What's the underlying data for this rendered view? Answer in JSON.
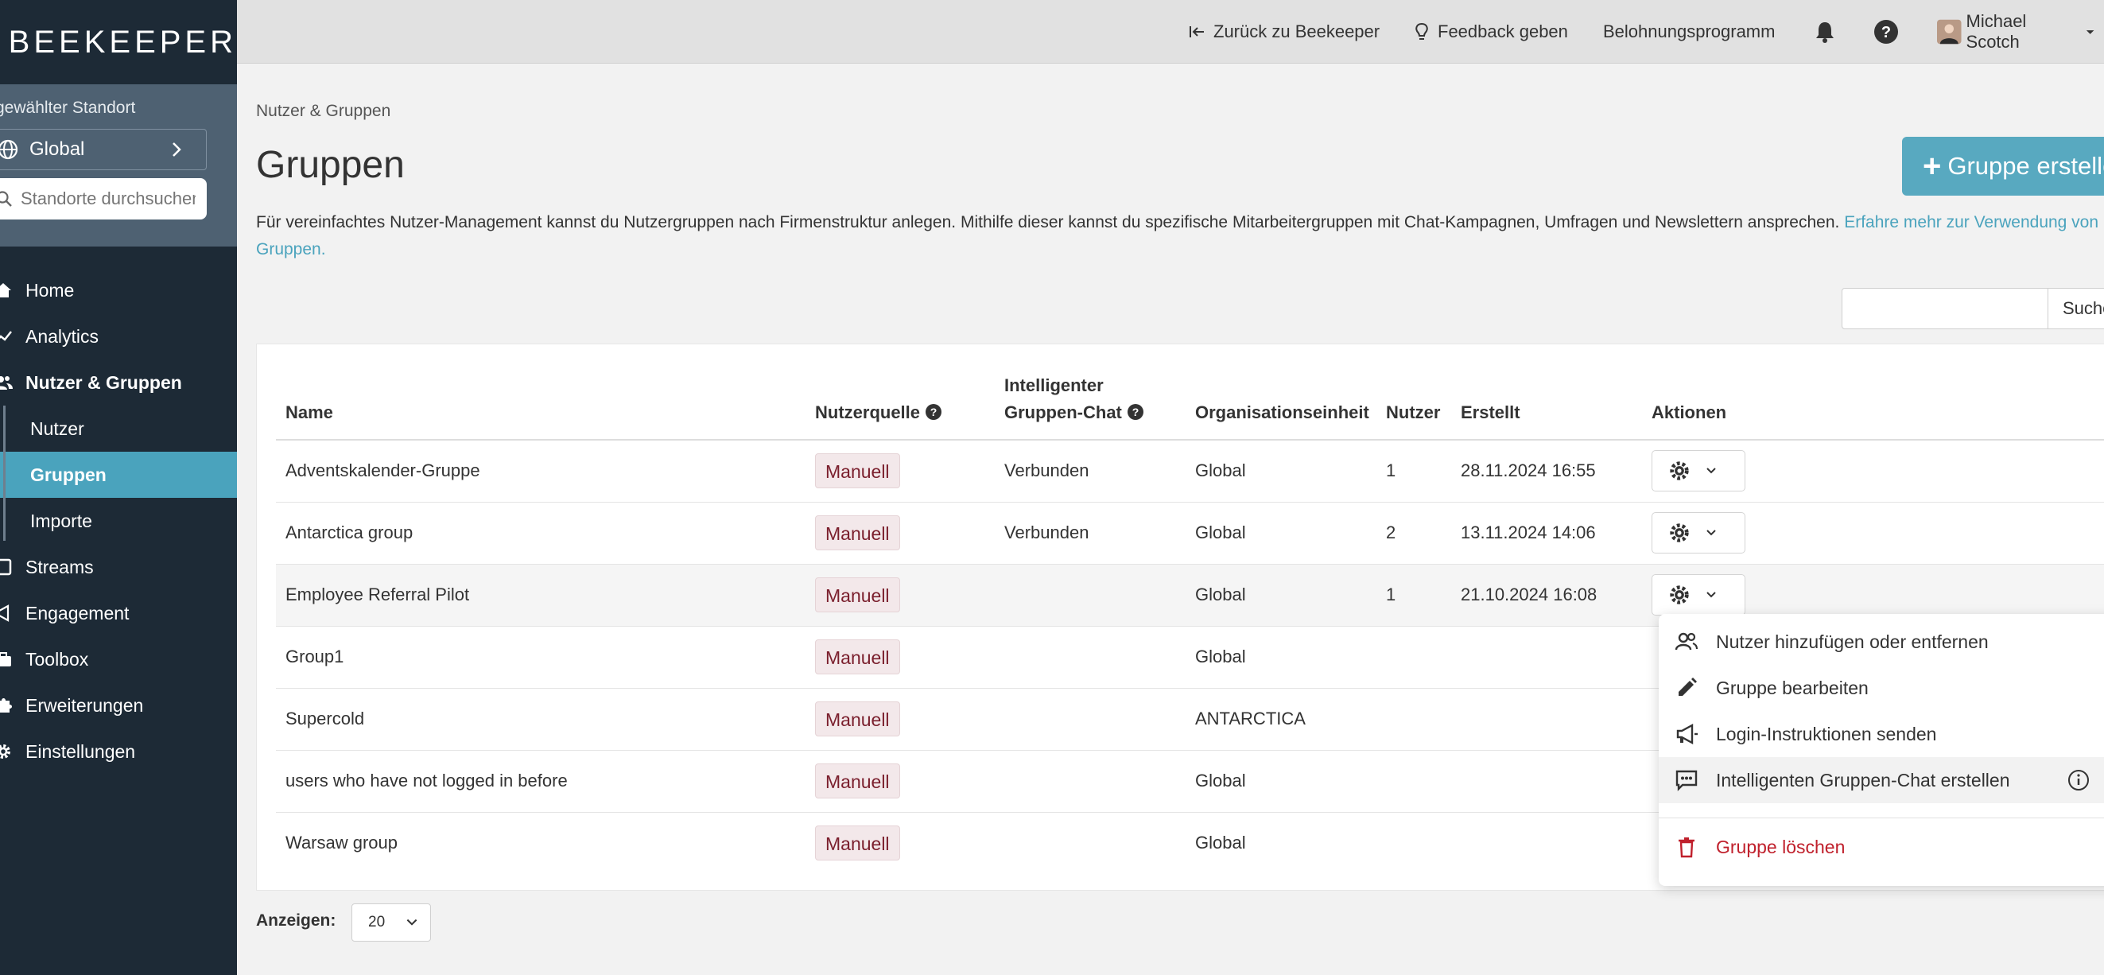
{
  "app": {
    "logo_text": "BEEKEEPER"
  },
  "sidebar": {
    "location_label": "gewählter Standort",
    "location_value": "Global",
    "location_search_placeholder": "Standorte durchsuchen",
    "nav": [
      {
        "label": "Home",
        "icon": "home-icon"
      },
      {
        "label": "Analytics",
        "icon": "chart-icon"
      },
      {
        "label": "Nutzer & Gruppen",
        "icon": "users-icon"
      },
      {
        "label": "Streams",
        "icon": "stream-icon"
      },
      {
        "label": "Engagement",
        "icon": "megaphone-icon"
      },
      {
        "label": "Toolbox",
        "icon": "toolbox-icon"
      },
      {
        "label": "Erweiterungen",
        "icon": "puzzle-icon"
      },
      {
        "label": "Einstellungen",
        "icon": "gear-icon"
      }
    ],
    "sub_nav": [
      {
        "label": "Nutzer"
      },
      {
        "label": "Gruppen"
      },
      {
        "label": "Importe"
      }
    ]
  },
  "topbar": {
    "back": "Zurück zu Beekeeper",
    "feedback": "Feedback geben",
    "rewards": "Belohnungsprogramm",
    "user": "Michael Scotch"
  },
  "page": {
    "breadcrumb": "Nutzer & Gruppen",
    "title": "Gruppen",
    "create_button": "Gruppe erstellen",
    "intro": "Für vereinfachtes Nutzer-Management kannst du Nutzergruppen nach Firmenstruktur anlegen. Mithilfe dieser kannst du spezifische Mitarbeitergruppen mit Chat-Kampagnen, Umfragen und Newslettern ansprechen.",
    "intro_link": "Erfahre mehr zur Verwendung von Gruppen.",
    "search_button": "Suchen",
    "show_label": "Anzeigen:",
    "page_size": "20"
  },
  "table": {
    "columns": {
      "name": "Name",
      "source": "Nutzerquelle",
      "chat_line1": "Intelligenter",
      "chat_line2": "Gruppen-Chat",
      "org": "Organisationseinheit",
      "users": "Nutzer",
      "created": "Erstellt",
      "actions": "Aktionen"
    },
    "rows": [
      {
        "name": "Adventskalender-Gruppe",
        "source": "Manuell",
        "chat": "Verbunden",
        "org": "Global",
        "users": "1",
        "created": "28.11.2024 16:55"
      },
      {
        "name": "Antarctica group",
        "source": "Manuell",
        "chat": "Verbunden",
        "org": "Global",
        "users": "2",
        "created": "13.11.2024 14:06"
      },
      {
        "name": "Employee Referral Pilot",
        "source": "Manuell",
        "chat": "",
        "org": "Global",
        "users": "1",
        "created": "21.10.2024 16:08"
      },
      {
        "name": "Group1",
        "source": "Manuell",
        "chat": "",
        "org": "Global",
        "users": "",
        "created": ""
      },
      {
        "name": "Supercold",
        "source": "Manuell",
        "chat": "",
        "org": "ANTARCTICA",
        "users": "",
        "created": ""
      },
      {
        "name": "users who have not logged in before",
        "source": "Manuell",
        "chat": "",
        "org": "Global",
        "users": "",
        "created": ""
      },
      {
        "name": "Warsaw group",
        "source": "Manuell",
        "chat": "",
        "org": "Global",
        "users": "",
        "created": ""
      }
    ]
  },
  "menu": {
    "items": [
      {
        "label": "Nutzer hinzufügen oder entfernen",
        "icon": "add-users-icon"
      },
      {
        "label": "Gruppe bearbeiten",
        "icon": "pencil-icon"
      },
      {
        "label": "Login-Instruktionen senden",
        "icon": "megaphone-icon"
      },
      {
        "label": "Intelligenten Gruppen-Chat erstellen",
        "icon": "chat-icon"
      },
      {
        "label": "Gruppe löschen",
        "icon": "trash-icon"
      }
    ]
  },
  "colors": {
    "sidebar_bg": "#1d2a36",
    "accent": "#4aa3bd",
    "danger": "#c0202c"
  }
}
